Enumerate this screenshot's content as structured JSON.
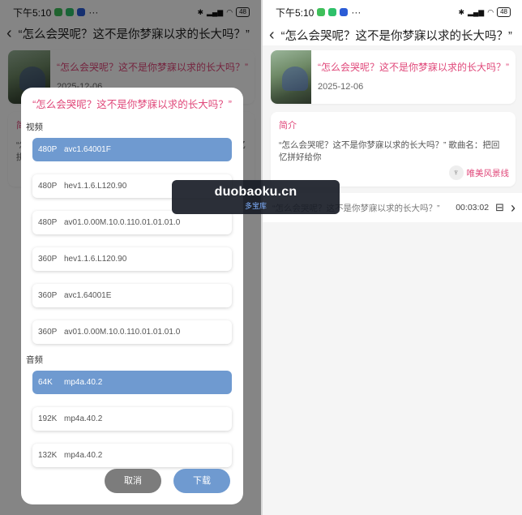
{
  "status": {
    "time": "下午5:10",
    "battery": "48"
  },
  "video": {
    "title": "“怎么会哭呢？这不是你梦寐以求的长大吗？”",
    "date": "2025-12-06"
  },
  "intro": {
    "heading": "简介",
    "text": "“怎么会哭呢？这不是你梦寐以求的长大吗？” 歌曲名：把回忆拼好给你",
    "author": "唯美风景线"
  },
  "track": {
    "title": "“怎么会哭呢？这不是你梦寐以求的长大吗？”",
    "duration": "00:03:02"
  },
  "dialog": {
    "title": "“怎么会哭呢？这不是你梦寐以求的长大吗？”",
    "video_label": "视频",
    "audio_label": "音频",
    "video_options": [
      {
        "quality": "480P",
        "codec": "avc1.64001F"
      },
      {
        "quality": "480P",
        "codec": "hev1.1.6.L120.90"
      },
      {
        "quality": "480P",
        "codec": "av01.0.00M.10.0.110.01.01.01.0"
      },
      {
        "quality": "360P",
        "codec": "hev1.1.6.L120.90"
      },
      {
        "quality": "360P",
        "codec": "avc1.64001E"
      },
      {
        "quality": "360P",
        "codec": "av01.0.00M.10.0.110.01.01.01.0"
      }
    ],
    "audio_options": [
      {
        "quality": "64K",
        "codec": "mp4a.40.2"
      },
      {
        "quality": "192K",
        "codec": "mp4a.40.2"
      },
      {
        "quality": "132K",
        "codec": "mp4a.40.2"
      }
    ],
    "cancel_label": "取消",
    "download_label": "下载"
  },
  "watermark": {
    "main": "duobaoku.cn",
    "sub": "多宝库"
  },
  "colors": {
    "accent_pink": "#e0487a",
    "accent_blue": "#6f9ad0",
    "cancel_gray": "#7c7c7c"
  }
}
